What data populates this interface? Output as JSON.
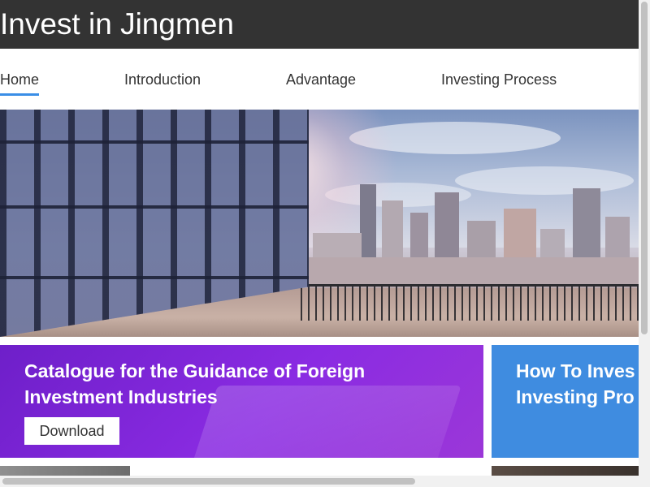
{
  "header": {
    "title": "Invest in Jingmen"
  },
  "nav": {
    "items": [
      {
        "label": "Home",
        "active": true
      },
      {
        "label": "Introduction",
        "active": false
      },
      {
        "label": "Advantage",
        "active": false
      },
      {
        "label": "Investing Process",
        "active": false
      }
    ]
  },
  "hero": {
    "image": "city-skyline-glass-building-photo"
  },
  "cards": [
    {
      "title_line1": "Catalogue for the Guidance of Foreign",
      "title_line2": "Investment Industries",
      "button_label": "Download",
      "color": "#8a2be2"
    },
    {
      "title_line1": "How To Inves",
      "title_line2": "Investing Pro",
      "color": "#3f8ce0"
    }
  ],
  "colors": {
    "header_bg": "#333333",
    "nav_active_underline": "#3a8ee6"
  }
}
